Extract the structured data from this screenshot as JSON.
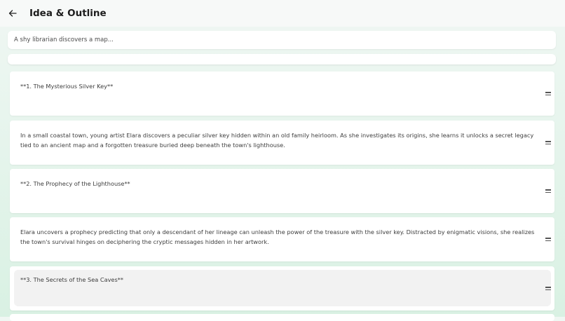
{
  "header": {
    "title": "Idea & Outline",
    "back_icon": "arrow-left-icon"
  },
  "idea": {
    "value": "A shy librarian discovers a map..."
  },
  "outline": {
    "items": [
      {
        "text": "**1. The Mysterious Silver Key**"
      },
      {
        "text": "In a small coastal town, young artist Elara discovers a peculiar silver key hidden within an old family heirloom. As she investigates its origins, she learns it unlocks a secret legacy tied to an ancient map and a forgotten treasure buried deep beneath the town's lighthouse."
      },
      {
        "text": "**2. The Prophecy of the Lighthouse**"
      },
      {
        "text": "Elara uncovers a prophecy predicting that only a descendant of her lineage can unleash the power of the treasure with the silver key. Distracted by enigmatic visions, she realizes the town's survival hinges on deciphering the cryptic messages hidden in her artwork."
      },
      {
        "text": "**3. The Secrets of the Sea Caves**"
      }
    ],
    "drag_icon": "drag-handle-icon"
  }
}
